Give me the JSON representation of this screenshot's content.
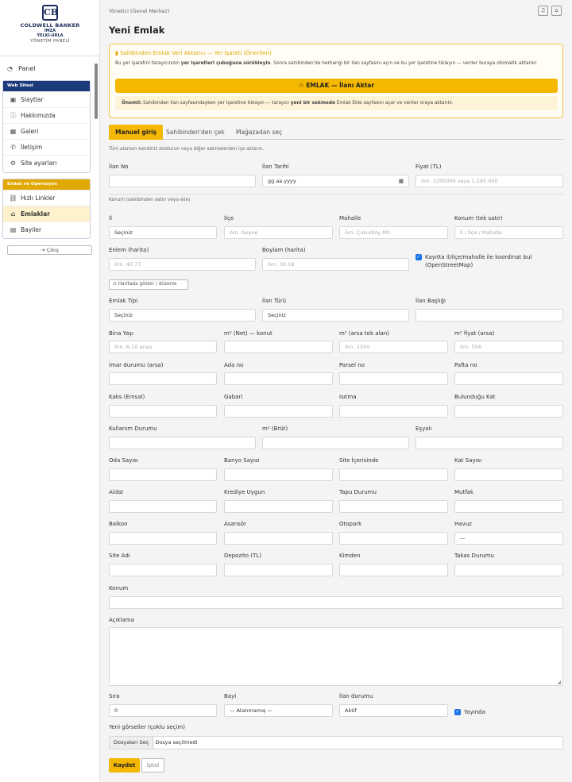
{
  "sidebar": {
    "logo_mark": "CB",
    "brand": "COLDWELL BANKER",
    "sub1": "İMZA",
    "sub2": "YELKİ-URLA",
    "panel": "YÖNETİM PANELİ",
    "panel_item": "Panel",
    "group_web": "Web Sitesi",
    "web_items": [
      "Slaytlar",
      "Hakkımızda",
      "Galeri",
      "İletişim",
      "Site ayarları"
    ],
    "group_ops": "Emlak ve Operasyon",
    "ops_items": [
      "Hızlı Linkler",
      "Emlaklar",
      "Bayiler"
    ],
    "logout": "Çıkış",
    "colors": {
      "web_header": "#1a3a7a",
      "ops_header": "#e0a800",
      "active_bg": "#fdf2cc"
    }
  },
  "header": {
    "breadcrumb": "Yönetici (Genel Merkez)",
    "title": "Yeni Emlak"
  },
  "banner": {
    "title": "Sahibinden Emlak Veri Aktarıcı — Yer İşareti (Önerilen)",
    "text_a": "Bu yer işaretini tarayıcınızın ",
    "text_b": "yer işaretleri çubuğuna sürükleyin",
    "text_c": ". Sonra sahibinden'de herhangi bir ilan sayfasını açın ve bu yer işaretine tıklayın — veriler buraya otomatik aktarılır.",
    "button": "EMLAK — İlanı Aktar",
    "note_a": "Önemli:",
    "note_b": " Sahibinden ilan sayfasındayken yer işaretine tıklayın — tarayıcı ",
    "note_c": "yeni bir sekmede",
    "note_d": " Emlak Ekle sayfasını açar ve veriler oraya aktarılır."
  },
  "tabs": [
    "Manuel giriş",
    "Sahibinden'den çek",
    "Mağazadan seç"
  ],
  "hint": "Tüm alanları kendiniz doldurun veya diğer sekmelerden içe aktarın.",
  "row1": {
    "ilan_no": "İlan No",
    "ilan_tarihi": "İlan Tarihi",
    "tarih_value": "gg.aa.yyyy",
    "fiyat": "Fiyat (TL)",
    "fiyat_ph": "örn. 1295000 veya 1.295.000"
  },
  "konum_note": "Konum (sahibinden satırı veya elle)",
  "row2": {
    "il": "İl",
    "il_value": "Seçiniz",
    "ilce": "İlçe",
    "ilce_ph": "örn. Geyve",
    "mahalle": "Mahalle",
    "mahalle_ph": "örn. Çukurköy Mh.",
    "konum_tek": "Konum (tek satır)",
    "konum_tek_ph": "İl / İlçe / Mahalle"
  },
  "row3": {
    "enlem": "Enlem (harita)",
    "enlem_ph": "örn. 40.77",
    "boylam": "Boylam (harita)",
    "boylam_ph": "örn. 30.18",
    "osm": "Kayıtta il/ilçe/mahalle ile koordinat bul (OpenStreetMap)"
  },
  "map_button": "Haritada göster / düzenle",
  "row4": {
    "emlak_tipi": "Emlak Tipi",
    "emlak_value": "Seçiniz",
    "ilan_turu": "İlan Türü",
    "ilan_turu_value": "Seçiniz",
    "ilan_basligi": "İlan Başlığı"
  },
  "row5": {
    "bina_yasi": "Bina Yaşı",
    "bina_ph": "örn. 6-10 arası",
    "m2_net": "m² (Net) — konut",
    "m2_arsa": "m² (arsa tek alan)",
    "m2_arsa_ph": "örn. 1350",
    "m2_fiyat": "m² fiyat (arsa)",
    "m2_fiyat_ph": "örn. 556"
  },
  "row6": [
    "İmar durumu (arsa)",
    "Ada no",
    "Parsel no",
    "Pafta no"
  ],
  "row7": [
    "Kaks (Emsal)",
    "Gabari",
    "Isıtma",
    "Bulunduğu Kat"
  ],
  "row8": [
    "Kullanım Durumu",
    "m² (Brüt)",
    "Eşyalı"
  ],
  "row9": [
    "Oda Sayısı",
    "Banyo Sayısı",
    "Site İçerisinde",
    "Kat Sayısı"
  ],
  "row10": [
    "Aidat",
    "Krediye Uygun",
    "Tapu Durumu",
    "Mutfak"
  ],
  "row11": {
    "labels": [
      "Balkon",
      "Asansör",
      "Otopark",
      "Havuz"
    ],
    "havuz_value": "—"
  },
  "row12": [
    "Site Adı",
    "Depozito (TL)",
    "Kimden",
    "Takas Durumu"
  ],
  "konum_label": "Konum",
  "aciklama_label": "Açıklama",
  "bottom": {
    "sira": "Sıra",
    "sira_value": "0",
    "bayi": "Bayi",
    "bayi_value": "— Atanmamış —",
    "durum": "İlan durumu",
    "durum_value": "Aktif",
    "yayinda": "Yayında"
  },
  "images": {
    "label": "Yeni görseller (çoklu seçim)",
    "button": "Dosyaları Seç",
    "status": "Dosya seçilmedi"
  },
  "actions": {
    "save": "Kaydet",
    "cancel": "İptal"
  }
}
